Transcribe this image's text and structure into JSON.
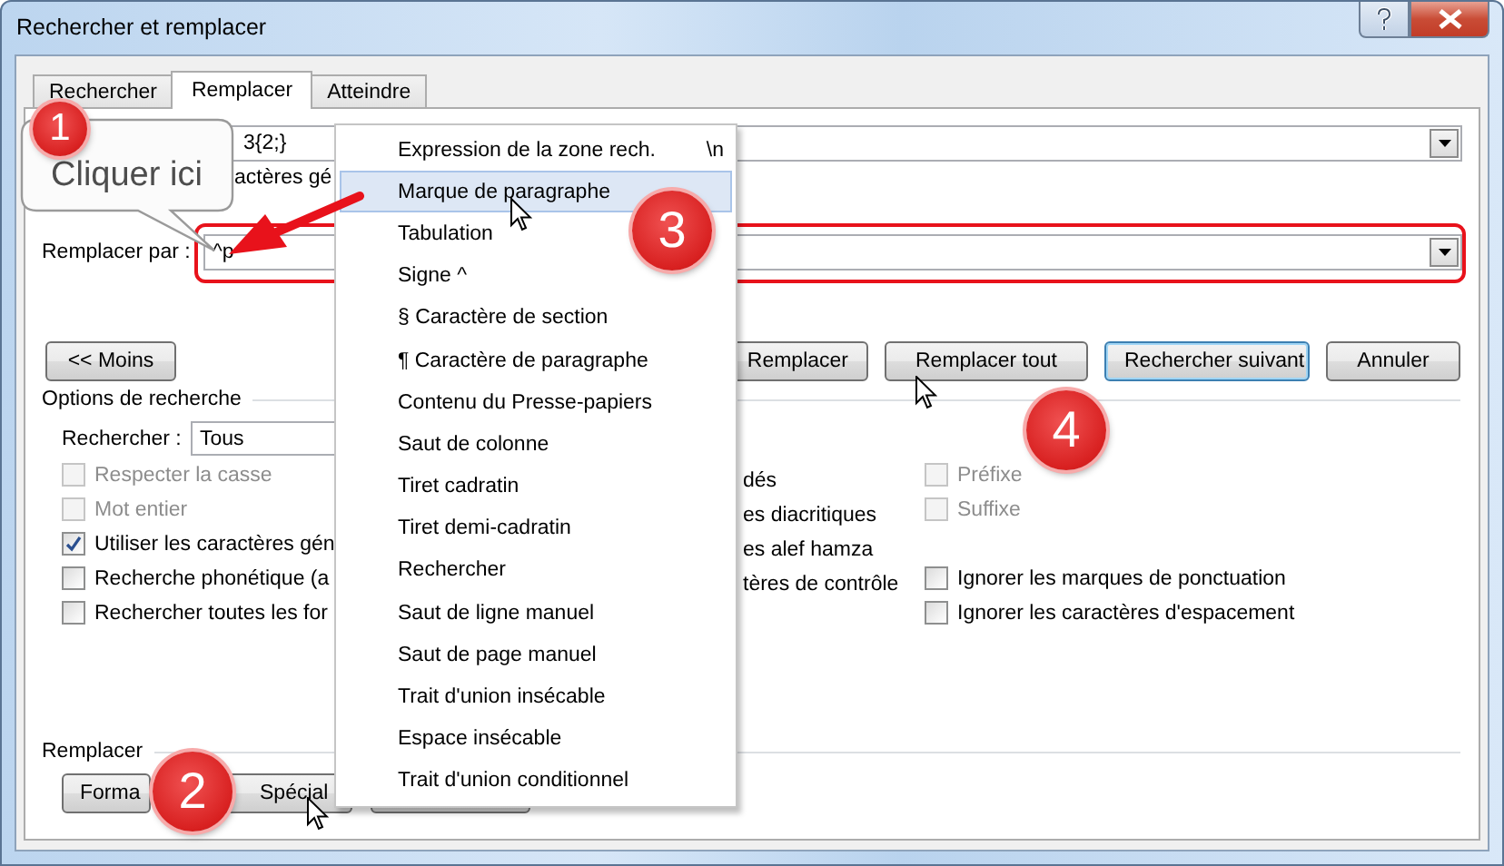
{
  "window": {
    "title": "Rechercher et remplacer"
  },
  "tabs": [
    {
      "label": "Rechercher",
      "selected": false
    },
    {
      "label": "Remplacer",
      "selected": true
    },
    {
      "label": "Atteindre",
      "selected": false
    }
  ],
  "find_field": {
    "value": "3{2;}"
  },
  "find_options_text": "actères gé",
  "replace_field": {
    "label": "Remplacer par :",
    "value": "^p"
  },
  "less_button": "<< Moins",
  "action_buttons": [
    {
      "label": "Remplacer",
      "default": false
    },
    {
      "label": "Remplacer tout",
      "default": false
    },
    {
      "label": "Rechercher suivant",
      "default": true
    },
    {
      "label": "Annuler",
      "default": false
    }
  ],
  "search_options": {
    "title": "Options de recherche",
    "search_label": "Rechercher :",
    "search_value": "Tous",
    "rows": [
      {
        "left": {
          "label": "Respecter la casse",
          "checked": false,
          "disabled": true
        },
        "middle": "dés",
        "right": {
          "label": "Préfixe",
          "checked": false,
          "disabled": true
        }
      },
      {
        "left": {
          "label": "Mot entier",
          "checked": false,
          "disabled": true
        },
        "middle": "es diacritiques",
        "right": {
          "label": "Suffixe",
          "checked": false,
          "disabled": true
        }
      },
      {
        "left": {
          "label": "Utiliser les caractères gén",
          "checked": true,
          "disabled": false
        },
        "middle": "es alef hamza"
      },
      {
        "left": {
          "label": "Recherche phonétique (a",
          "checked": false,
          "disabled": false
        },
        "middle": "tères de contrôle",
        "right": {
          "label": "Ignorer les marques de ponctuation",
          "checked": false,
          "disabled": false
        }
      },
      {
        "left": {
          "label": "Rechercher toutes les for",
          "checked": false,
          "disabled": false
        },
        "right": {
          "label": "Ignorer les caractères d'espacement",
          "checked": false,
          "disabled": false
        }
      }
    ]
  },
  "replace_group": {
    "title": "Remplacer",
    "buttons": [
      {
        "kind": "plain",
        "label": "Forma"
      },
      {
        "kind": "dropdown",
        "label": "Spécial"
      },
      {
        "kind": "blank"
      }
    ]
  },
  "menu": {
    "items": [
      {
        "label": "Expression de la zone rech.",
        "shortcut": "\\n",
        "selected": false
      },
      {
        "label": "Marque de paragraphe",
        "selected": true
      },
      {
        "label": "Tabulation",
        "selected": false
      },
      {
        "label": "Signe ^",
        "selected": false
      },
      {
        "label": "§ Caractère de section",
        "selected": false
      },
      {
        "label": "¶ Caractère de paragraphe",
        "selected": false
      },
      {
        "label": "Contenu du Presse-papiers",
        "selected": false
      },
      {
        "label": "Saut de colonne",
        "selected": false
      },
      {
        "label": "Tiret cadratin",
        "selected": false
      },
      {
        "label": "Tiret demi-cadratin",
        "selected": false
      },
      {
        "label": "Rechercher",
        "selected": false
      },
      {
        "label": "Saut de ligne manuel",
        "selected": false
      },
      {
        "label": "Saut de page manuel",
        "selected": false
      },
      {
        "label": "Trait d'union insécable",
        "selected": false
      },
      {
        "label": "Espace insécable",
        "selected": false
      },
      {
        "label": "Trait d'union conditionnel",
        "selected": false
      }
    ]
  },
  "annotations": {
    "callout": "Cliquer ici",
    "steps": [
      "1",
      "2",
      "3",
      "4"
    ]
  }
}
